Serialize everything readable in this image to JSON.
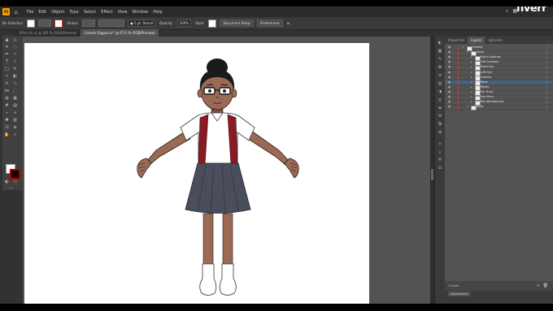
{
  "app": {
    "logo": "Ai",
    "home_icon": "home-icon"
  },
  "menu": [
    "File",
    "Edit",
    "Object",
    "Type",
    "Select",
    "Effect",
    "View",
    "Window",
    "Help"
  ],
  "brand": "fiverr",
  "control": {
    "selection": "No Selection",
    "stroke_label": "Stroke:",
    "brush": "5 pt. Round",
    "brush_label": "Basic",
    "opacity_label": "Opacity:",
    "opacity_value": "100%",
    "style_label": "Style:",
    "document_setup": "Document Setup",
    "preferences": "Preferences"
  },
  "tabs": [
    {
      "label": "Mitra Ali.ai @ 100 % (RGB/Preview)",
      "active": false
    },
    {
      "label": "Celeste Rigged.ai* @ 67.6 % (RGB/Preview)",
      "active": true
    }
  ],
  "panel": {
    "tabs": [
      "Properties",
      "Layers",
      "Libraries"
    ],
    "active_tab": "Layers",
    "layers": [
      {
        "name": "Celeste",
        "indent": 0,
        "color": "#e23b3b"
      },
      {
        "name": "Head",
        "indent": 1,
        "color": "#e23b3b"
      },
      {
        "name": "Right Eyebrow",
        "indent": 2,
        "color": "#e23b3b"
      },
      {
        "name": "Left Eyebrow",
        "indent": 2,
        "color": "#e23b3b"
      },
      {
        "name": "Right Eye",
        "indent": 2,
        "color": "#e23b3b"
      },
      {
        "name": "Left Eye",
        "indent": 2,
        "color": "#e23b3b"
      },
      {
        "name": "Glasses",
        "indent": 2,
        "color": "#e23b3b"
      },
      {
        "name": "Nose",
        "indent": 2,
        "color": "#e23b3b",
        "selected": true
      },
      {
        "name": "Mouth",
        "indent": 2,
        "color": "#e23b3b"
      },
      {
        "name": "Ear Front",
        "indent": 2,
        "color": "#e23b3b"
      },
      {
        "name": "Hair Back",
        "indent": 2,
        "color": "#e23b3b"
      },
      {
        "name": "Bun Background",
        "indent": 2,
        "color": "#e23b3b"
      },
      {
        "name": "Body",
        "indent": 1,
        "color": "#e23b3b"
      }
    ],
    "footer": "1 Layer",
    "footer_tab": "Appearance"
  },
  "colors": {
    "skin": "#9b6a55",
    "skin_dark": "#7c5040",
    "hair": "#1a1a1a",
    "shirt": "#ffffff",
    "suspender": "#8b1a22",
    "skirt": "#4a4e5c",
    "skirt_dark": "#3a3e4a",
    "sock": "#ffffff",
    "accent_select": "#46617c"
  }
}
